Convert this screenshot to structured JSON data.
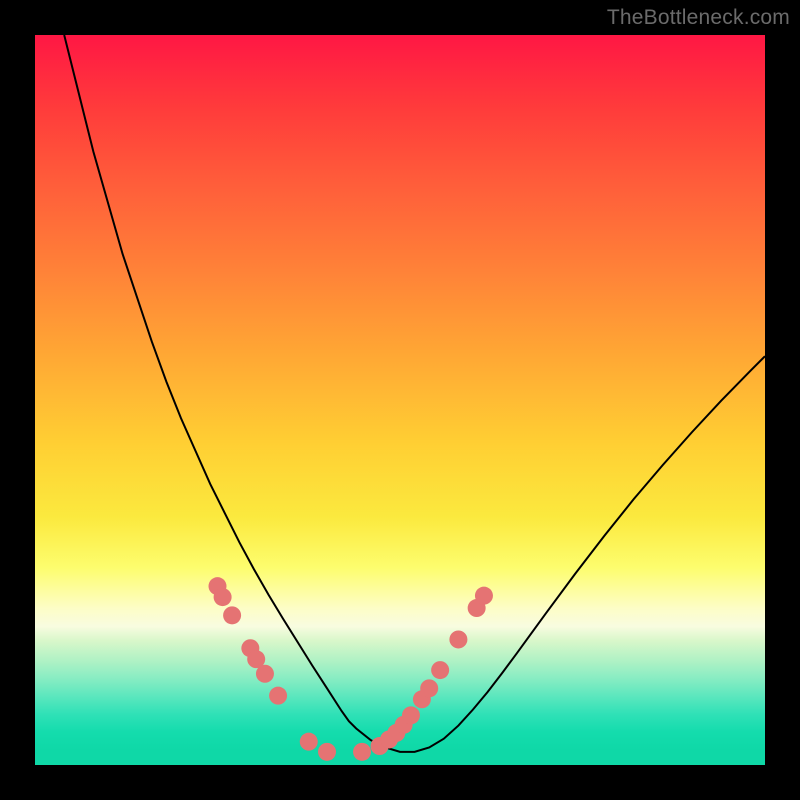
{
  "watermark": "TheBottleneck.com",
  "chart_data": {
    "type": "line",
    "title": "",
    "xlabel": "",
    "ylabel": "",
    "xlim": [
      0,
      100
    ],
    "ylim": [
      0,
      100
    ],
    "background_gradient": {
      "direction": "vertical",
      "stops": [
        {
          "pos": 0,
          "color": "#ff1744"
        },
        {
          "pos": 0.1,
          "color": "#ff3b3b"
        },
        {
          "pos": 0.2,
          "color": "#ff5c3a"
        },
        {
          "pos": 0.32,
          "color": "#ff8138"
        },
        {
          "pos": 0.44,
          "color": "#ffa834"
        },
        {
          "pos": 0.56,
          "color": "#ffcf33"
        },
        {
          "pos": 0.66,
          "color": "#fbe93e"
        },
        {
          "pos": 0.73,
          "color": "#fdfd6e"
        },
        {
          "pos": 0.785,
          "color": "#fdfdc6"
        },
        {
          "pos": 0.81,
          "color": "#f8fce0"
        },
        {
          "pos": 0.83,
          "color": "#d8f7ca"
        },
        {
          "pos": 0.855,
          "color": "#b3f2c5"
        },
        {
          "pos": 0.88,
          "color": "#8aedc3"
        },
        {
          "pos": 0.905,
          "color": "#5de7be"
        },
        {
          "pos": 0.93,
          "color": "#30e1b7"
        },
        {
          "pos": 0.955,
          "color": "#14dcad"
        },
        {
          "pos": 1.0,
          "color": "#0fd8a7"
        }
      ]
    },
    "series": [
      {
        "name": "bottleneck-curve",
        "stroke": "#000000",
        "stroke_width": 2,
        "x": [
          4,
          6,
          8,
          10,
          12,
          14,
          16,
          18,
          20,
          22,
          24,
          26,
          28,
          30,
          32,
          34,
          36,
          38,
          40,
          42,
          43,
          44,
          46,
          48,
          50,
          52,
          54,
          56,
          58,
          60,
          62,
          64,
          66,
          70,
          74,
          78,
          82,
          86,
          90,
          94,
          98,
          100
        ],
        "y": [
          100,
          92,
          84,
          77,
          70,
          64,
          58,
          52.5,
          47.5,
          43,
          38.5,
          34.5,
          30.5,
          26.8,
          23.3,
          20,
          16.8,
          13.6,
          10.5,
          7.4,
          6,
          5,
          3.4,
          2.4,
          1.8,
          1.8,
          2.4,
          3.6,
          5.4,
          7.6,
          10,
          12.6,
          15.3,
          20.8,
          26.2,
          31.4,
          36.4,
          41.1,
          45.6,
          49.9,
          54,
          56
        ]
      }
    ],
    "markers": [
      {
        "name": "left-cluster",
        "shape": "circle",
        "color": "#e57373",
        "radius": 9,
        "points": [
          {
            "x": 25.0,
            "y": 24.5
          },
          {
            "x": 25.7,
            "y": 23.0
          },
          {
            "x": 27.0,
            "y": 20.5
          },
          {
            "x": 29.5,
            "y": 16.0
          },
          {
            "x": 30.3,
            "y": 14.5
          },
          {
            "x": 31.5,
            "y": 12.5
          },
          {
            "x": 33.3,
            "y": 9.5
          },
          {
            "x": 37.5,
            "y": 3.2
          },
          {
            "x": 40.0,
            "y": 1.8
          }
        ]
      },
      {
        "name": "right-cluster",
        "shape": "circle",
        "color": "#e57373",
        "radius": 9,
        "points": [
          {
            "x": 44.8,
            "y": 1.8
          },
          {
            "x": 47.2,
            "y": 2.6
          },
          {
            "x": 48.5,
            "y": 3.5
          },
          {
            "x": 49.5,
            "y": 4.4
          },
          {
            "x": 50.5,
            "y": 5.5
          },
          {
            "x": 51.5,
            "y": 6.8
          },
          {
            "x": 53.0,
            "y": 9.0
          },
          {
            "x": 54.0,
            "y": 10.5
          },
          {
            "x": 55.5,
            "y": 13.0
          },
          {
            "x": 58.0,
            "y": 17.2
          },
          {
            "x": 60.5,
            "y": 21.5
          },
          {
            "x": 61.5,
            "y": 23.2
          }
        ]
      }
    ]
  }
}
